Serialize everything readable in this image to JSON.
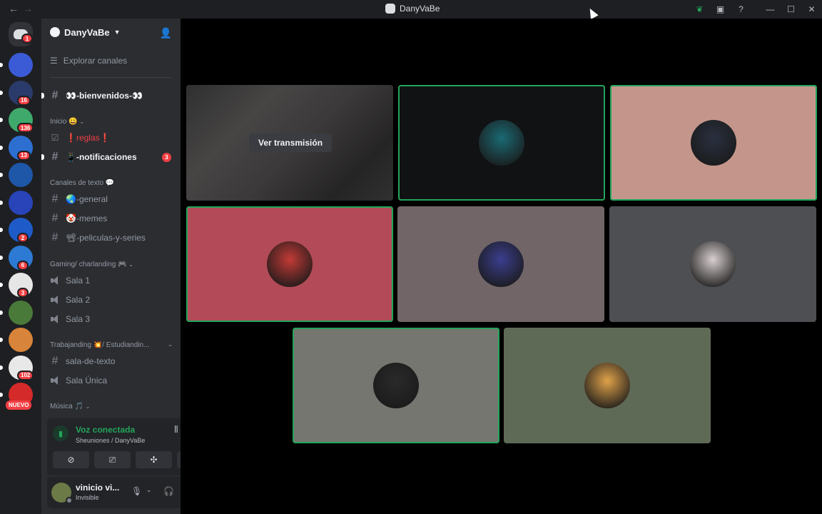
{
  "window": {
    "title": "DanyVaBe",
    "controls": {
      "minimize": "—",
      "maximize": "☐",
      "close": "✕"
    }
  },
  "server_rail": {
    "home_badge": "1",
    "servers": [
      {
        "badge": "",
        "color": "#3b5bd6"
      },
      {
        "badge": "16",
        "color": "#2a3a6a"
      },
      {
        "badge": "136",
        "color": "#3fa96b"
      },
      {
        "badge": "13",
        "color": "#2d6fd1"
      },
      {
        "badge": "",
        "color": "#1e56a8"
      },
      {
        "badge": "",
        "color": "#2844b8"
      },
      {
        "badge": "2",
        "color": "#1e5bc8"
      },
      {
        "badge": "6",
        "color": "#2d7ad4"
      },
      {
        "badge": "3",
        "color": "#e6e6e6"
      },
      {
        "badge": "",
        "color": "#4a7a3a"
      },
      {
        "badge": "",
        "color": "#d8843a"
      },
      {
        "badge": "102",
        "color": "#e8e8e8"
      },
      {
        "badge": "",
        "color": "#d42a2a"
      }
    ],
    "new_label": "NUEVO"
  },
  "sidebar": {
    "guild_name": "DanyVaBe",
    "explore_label": "Explorar canales",
    "channels_top": [
      {
        "label": "👀-bienvenidos-👀",
        "bold": true
      }
    ],
    "category_inicio": "Inicio 😀",
    "inicio_channels": [
      {
        "label": "❗reglas❗",
        "bold": false
      },
      {
        "label": "📱-notificaciones",
        "bold": true,
        "mention": "3"
      }
    ],
    "category_texto": "Canales de texto 💬",
    "texto_channels": [
      {
        "label": "🌏-general"
      },
      {
        "label": "🤡-memes"
      },
      {
        "label": "📽-peliculas-y-series"
      }
    ],
    "category_gaming": "Gaming/ charlanding 🎮",
    "gaming_channels": [
      "Sala 1",
      "Sala 2",
      "Sala 3"
    ],
    "category_trabajo": "Trabajanding 💥/ Estudiandin...",
    "trabajo_channels": [
      {
        "label": "sala-de-texto",
        "type": "text"
      },
      {
        "label": "Sala Única",
        "type": "voice"
      }
    ],
    "category_musica": "Música 🎵"
  },
  "voice_panel": {
    "status": "Voz conectada",
    "location": "Sheuniones / DanyVaBe"
  },
  "user_panel": {
    "name": "vinicio vi...",
    "status": "Invisible"
  },
  "grid": {
    "stream_button": "Ver transmisión",
    "tiles": [
      {
        "bg": "#111214",
        "avatar": "#1a6a74",
        "speaking": true
      },
      {
        "bg": "#c4968b",
        "avatar": "#2a3040",
        "speaking": true
      },
      {
        "bg": "#b24b57",
        "avatar": "#c23a36",
        "speaking": true
      },
      {
        "bg": "#716567",
        "avatar": "#3b3e8e",
        "speaking": false
      },
      {
        "bg": "#4e4f52",
        "avatar": "#d9cfcf",
        "speaking": false
      },
      {
        "bg": "#767670",
        "avatar": "#2a2a2a",
        "speaking": true
      },
      {
        "bg": "#5f6a56",
        "avatar": "#e0a24a",
        "speaking": false
      }
    ]
  }
}
